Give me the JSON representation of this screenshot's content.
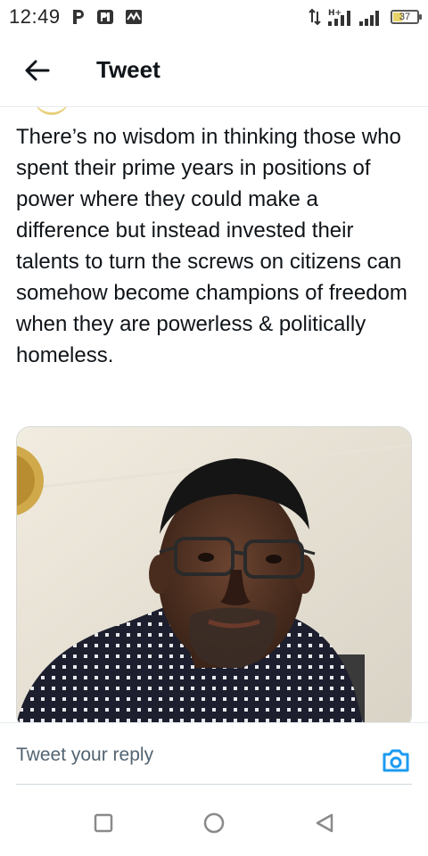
{
  "status_bar": {
    "time": "12:49",
    "left_icons": [
      "p-app-icon",
      "pi-app-icon",
      "activity-icon"
    ],
    "right_icons": [
      "data-transfer-icon",
      "signal-h-plus-icon",
      "signal-icon"
    ],
    "battery_level": "37"
  },
  "header": {
    "back_icon": "arrow-left-icon",
    "title": "Tweet"
  },
  "tweet": {
    "text": "There’s no wisdom in thinking those who spent their prime years in positions of power where they could make a difference but instead invested their talents to turn the screws on citizens can somehow become champions of freedom when they are powerless & politically homeless.",
    "photo_description": "selfie-photo"
  },
  "reply": {
    "placeholder": "Tweet your reply",
    "camera_icon": "camera-icon"
  },
  "nav_bar": {
    "buttons": [
      "recents-square-icon",
      "home-circle-icon",
      "back-triangle-icon"
    ]
  },
  "colors": {
    "accent": "#1d9bf0",
    "text": "#0f1419",
    "muted": "#536471"
  }
}
